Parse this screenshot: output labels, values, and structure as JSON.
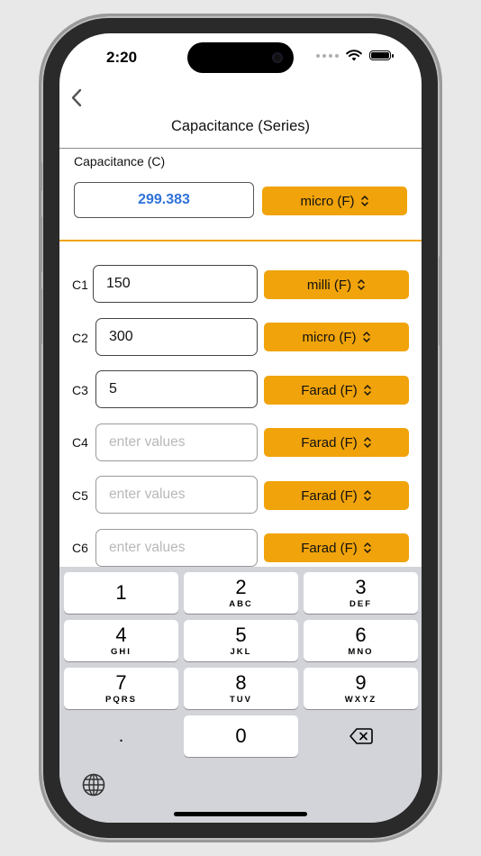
{
  "status": {
    "time": "2:20"
  },
  "nav": {
    "title": "Capacitance (Series)"
  },
  "result": {
    "label": "Capacitance (C)",
    "value": "299.383",
    "unit": "micro (F)"
  },
  "inputs": [
    {
      "label": "C1",
      "value": "150",
      "placeholder": "enter values",
      "unit": "milli (F)"
    },
    {
      "label": "C2",
      "value": "300",
      "placeholder": "enter values",
      "unit": "micro (F)"
    },
    {
      "label": "C3",
      "value": "5",
      "placeholder": "enter values",
      "unit": "Farad (F)"
    },
    {
      "label": "C4",
      "value": "",
      "placeholder": "enter values",
      "unit": "Farad (F)"
    },
    {
      "label": "C5",
      "value": "",
      "placeholder": "enter values",
      "unit": "Farad (F)"
    },
    {
      "label": "C6",
      "value": "",
      "placeholder": "enter values",
      "unit": "Farad (F)"
    }
  ],
  "keyboard": {
    "keys": [
      {
        "num": "1",
        "letters": ""
      },
      {
        "num": "2",
        "letters": "ABC"
      },
      {
        "num": "3",
        "letters": "DEF"
      },
      {
        "num": "4",
        "letters": "GHI"
      },
      {
        "num": "5",
        "letters": "JKL"
      },
      {
        "num": "6",
        "letters": "MNO"
      },
      {
        "num": "7",
        "letters": "PQRS"
      },
      {
        "num": "8",
        "letters": "TUV"
      },
      {
        "num": "9",
        "letters": "WXYZ"
      },
      {
        "num": ".",
        "letters": ""
      },
      {
        "num": "0",
        "letters": ""
      }
    ],
    "delete_icon": "delete-left-icon",
    "globe_icon": "globe-icon"
  },
  "colors": {
    "accent": "#f0a30a",
    "result_text": "#2f72d9",
    "keyboard_bg": "#d2d4d9"
  }
}
